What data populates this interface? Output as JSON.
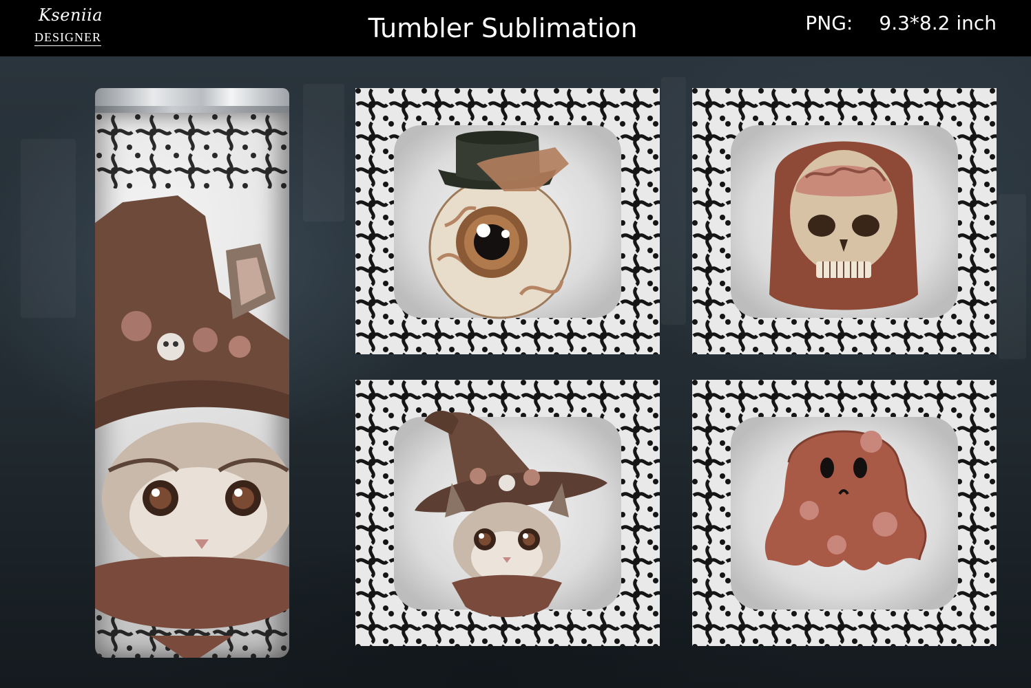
{
  "header": {
    "logo_script": "Kseniia",
    "logo_sub": "DESIGNER",
    "title": "Tumbler Sublimation",
    "spec_label": "PNG:",
    "spec_value": "9.3*8.2 inch"
  },
  "colors": {
    "header_bg": "#000000",
    "lace": "#161616",
    "paper": "#e6e6e6",
    "copper": "#8a4e3c",
    "brown": "#6b4a3a"
  },
  "images": {
    "tumbler": "cat-witch-tumbler-mockup",
    "tile_1": "eyeball-with-hat-icon",
    "tile_2": "lace-skull-brain-icon",
    "tile_3": "cat-witch-hat-icon",
    "tile_4": "lace-ghost-icon"
  }
}
